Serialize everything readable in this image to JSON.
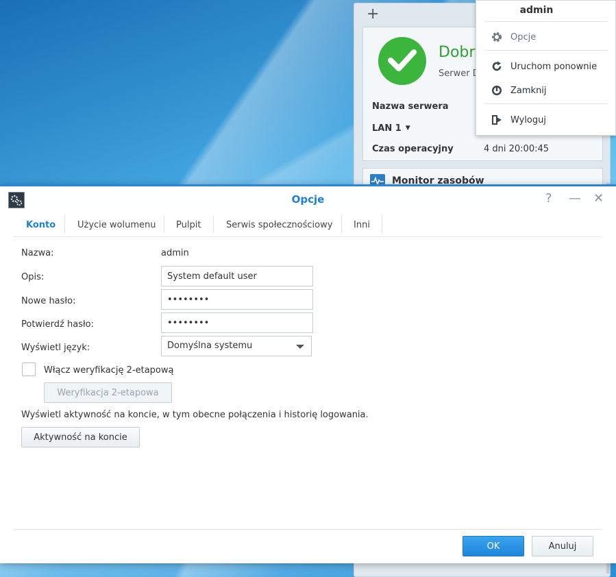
{
  "widgets": {
    "add_symbol": "+",
    "health_title": "Dobry",
    "health_subtitle": "Serwer D",
    "server_name_label": "Nazwa serwera",
    "lan_label": "LAN 1",
    "uptime_label": "Czas operacyjny",
    "uptime_value": "4 dni 20:00:45",
    "monitor_title": "Monitor zasobów"
  },
  "user_menu": {
    "username": "admin",
    "items": [
      {
        "label": "Opcje",
        "icon": "gear-icon"
      },
      {
        "label": "Uruchom ponownie",
        "icon": "restart-icon"
      },
      {
        "label": "Zamknij",
        "icon": "power-icon"
      },
      {
        "label": "Wyloguj",
        "icon": "logout-icon"
      }
    ]
  },
  "window": {
    "title": "Opcje",
    "controls": {
      "help": "?",
      "minimize": "—",
      "close": "✕"
    },
    "tabs": [
      "Konto",
      "Użycie wolumenu",
      "Pulpit",
      "Serwis społecznościowy",
      "Inni"
    ],
    "active_tab": "Konto"
  },
  "form": {
    "name_label": "Nazwa:",
    "name_value": "admin",
    "description_label": "Opis:",
    "description_value": "System default user",
    "new_password_label": "Nowe hasło:",
    "new_password_value": "••••••••",
    "confirm_password_label": "Potwierdź hasło:",
    "confirm_password_value": "••••••••",
    "language_label": "Wyświetl język:",
    "language_value": "Domyślna systemu",
    "two_step_checkbox_label": "Włącz weryfikację 2-etapową",
    "two_step_checked": false,
    "two_step_button": "Weryfikacja 2-etapowa",
    "activity_text": "Wyświetl aktywność na koncie, w tym obecne połączenia i historię logowania.",
    "activity_button": "Aktywność na koncie"
  },
  "footer": {
    "ok": "OK",
    "cancel": "Anuluj"
  },
  "colors": {
    "accent": "#1f7fd0",
    "healthy": "#3bb53b"
  }
}
